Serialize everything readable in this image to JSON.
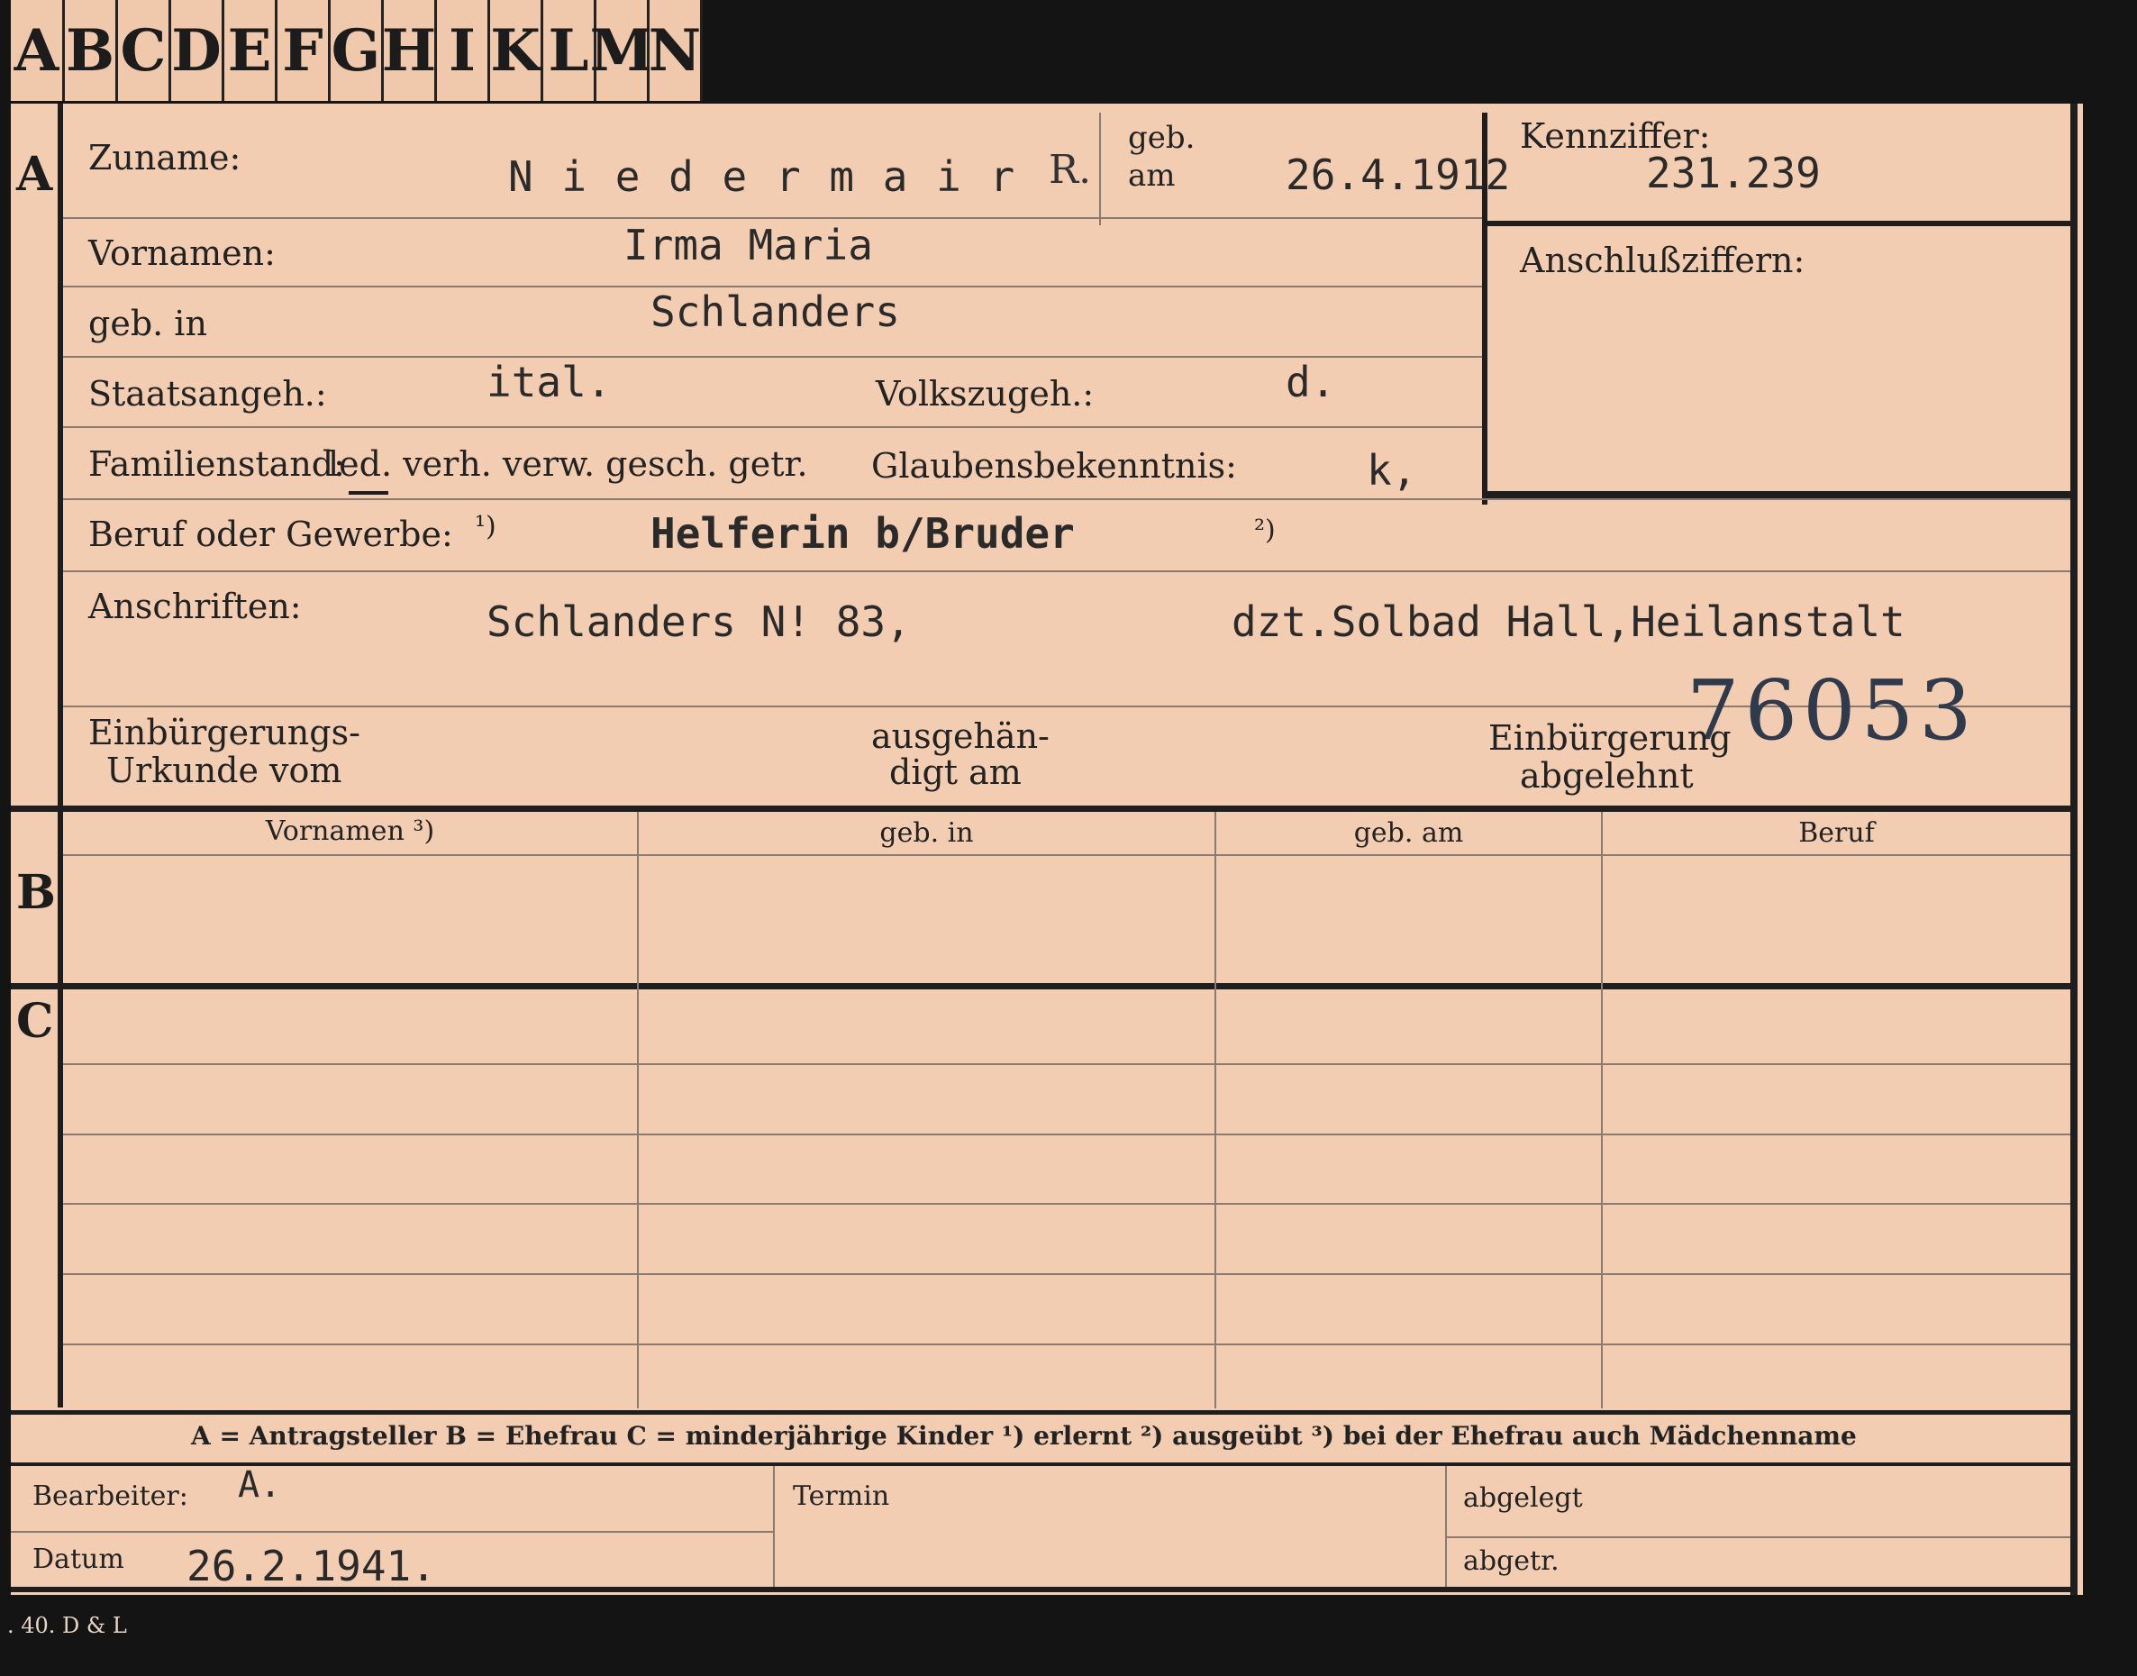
{
  "tabs": [
    "A",
    "B",
    "C",
    "D",
    "E",
    "F",
    "G",
    "H",
    "I",
    "K",
    "L",
    "M",
    "N"
  ],
  "section_labels": {
    "a": "A",
    "b": "B",
    "c": "C"
  },
  "labels": {
    "zuname": "Zuname:",
    "geb_am_1": "geb.",
    "geb_am_2": "am",
    "kennziffer": "Kennziffer:",
    "vornamen": "Vornamen:",
    "geb_in": "geb. in",
    "anschlussziffern": "Anschlußziffern:",
    "staatsangeh": "Staatsangeh.:",
    "volkszugeh": "Volkszugeh.:",
    "familienstand": "Familienstand:",
    "familienstand_options": "led. verh. verw. gesch. getr.",
    "glaubensbekenntnis": "Glaubensbekenntnis:",
    "beruf": "Beruf oder Gewerbe:",
    "note1": "¹)",
    "note2": "²)",
    "anschriften": "Anschriften:",
    "einbuergerung_urkunde_1": "Einbürgerungs-",
    "einbuergerung_urkunde_2": "Urkunde vom",
    "ausgehaendigt_1": "ausgehän-",
    "ausgehaendigt_2": "digt am",
    "einbuergerung_abgelehnt_1": "Einbürgerung",
    "einbuergerung_abgelehnt_2": "abgelehnt",
    "legend": "A = Antragsteller   B = Ehefrau   C = minderjährige Kinder   ¹) erlernt   ²) ausgeübt   ³) bei der Ehefrau auch Mädchenname",
    "bearbeiter": "Bearbeiter:",
    "datum": "Datum",
    "termin": "Termin",
    "abgelegt": "abgelegt",
    "abgetr": "abgetr.",
    "footer": ". 40. D & L"
  },
  "columns": [
    "Vornamen ³)",
    "geb. in",
    "geb. am",
    "Beruf"
  ],
  "values": {
    "zuname": "N i e d e r m a i r",
    "zuname_mark": "R.",
    "geb_am": "26.4.1912",
    "kennziffer": "231.239",
    "vornamen": "Irma Maria",
    "geb_in": "Schlanders",
    "staatsangeh": "ital.",
    "volkszugeh": "d.",
    "glaubensbekenntnis": "k,",
    "beruf": "Helferin b/Bruder",
    "anschrift_1": "Schlanders N! 83,",
    "anschrift_2": "dzt.Solbad  Hall,Heilanstalt",
    "stamp_number": "76053",
    "bearbeiter": "A.",
    "datum": "26.2.1941."
  },
  "colors": {
    "card": "#f2cdb2",
    "border": "#1e1e1e",
    "background": "#141414"
  }
}
